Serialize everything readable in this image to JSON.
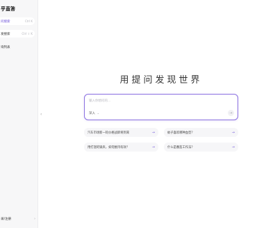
{
  "sidebar": {
    "brand": "乎直答",
    "items": [
      {
        "label": "问搜索",
        "shortcut": "Ctrl K"
      },
      {
        "label": "发搜索",
        "shortcut": "Ctrl ⇧ K"
      }
    ],
    "list_label": "询列表",
    "footer_label": "录/注册",
    "footer_chevron": "›"
  },
  "collapse_handle": "‹",
  "hero": {
    "title": "用提问发现世界"
  },
  "ask": {
    "placeholder": "输入你想问的...",
    "depth_label": "深入",
    "depth_chevron": "⌄",
    "send_icon": "→"
  },
  "suggestions": [
    {
      "label": "汽车市场新一轮价格战即将到来",
      "arrow": "→"
    },
    {
      "label": "蚊子喜欢哪种血型？",
      "arrow": "→"
    },
    {
      "label": "用打湿的锅夹，如何维持有效？",
      "arrow": "→"
    },
    {
      "label": "什么是番茄工作法？",
      "arrow": "→"
    }
  ],
  "colors": {
    "accent": "#6b4fd8",
    "border": "#8a6fe0"
  }
}
